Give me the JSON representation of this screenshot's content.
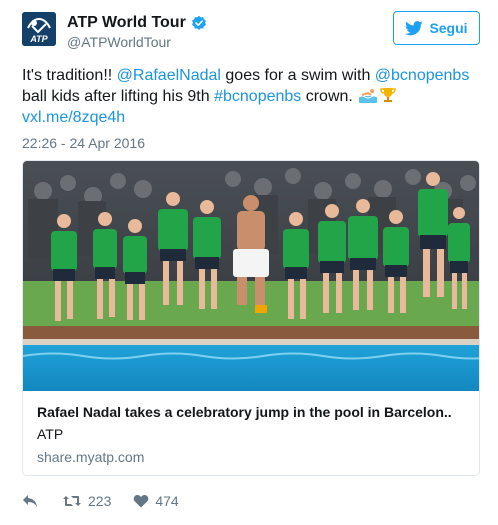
{
  "account": {
    "display_name": "ATP World Tour",
    "handle": "@ATPWorldTour",
    "logo_text": "ATP",
    "verified_icon": "verified-badge-icon"
  },
  "follow_button": {
    "label": "Segui",
    "icon": "twitter-bird-icon",
    "color": "#1da1f2"
  },
  "tweet": {
    "t1": "It's tradition!! ",
    "m1": "@RafaelNadal",
    "t2": " goes for a swim with ",
    "m2": "@bcnopenbs",
    "t3": " ball kids after lifting his 9th ",
    "h1": "#bcnopenbs",
    "t4": " crown. ",
    "emoji": [
      "swimmer-icon",
      "trophy-icon"
    ],
    "link": "vxl.me/8zqe4h",
    "link_color": "#1b95e0",
    "timestamp": "22:26 - 24 Apr 2016"
  },
  "card": {
    "image": "ball-kids-jumping-into-pool-photo",
    "title": "Rafael Nadal takes a celebratory jump in the pool in Barcelon..",
    "description": "ATP",
    "domain": "share.myatp.com"
  },
  "actions": {
    "reply_icon": "reply-icon",
    "retweet_icon": "retweet-icon",
    "retweet_count": "223",
    "like_icon": "heart-icon",
    "like_count": "474"
  }
}
